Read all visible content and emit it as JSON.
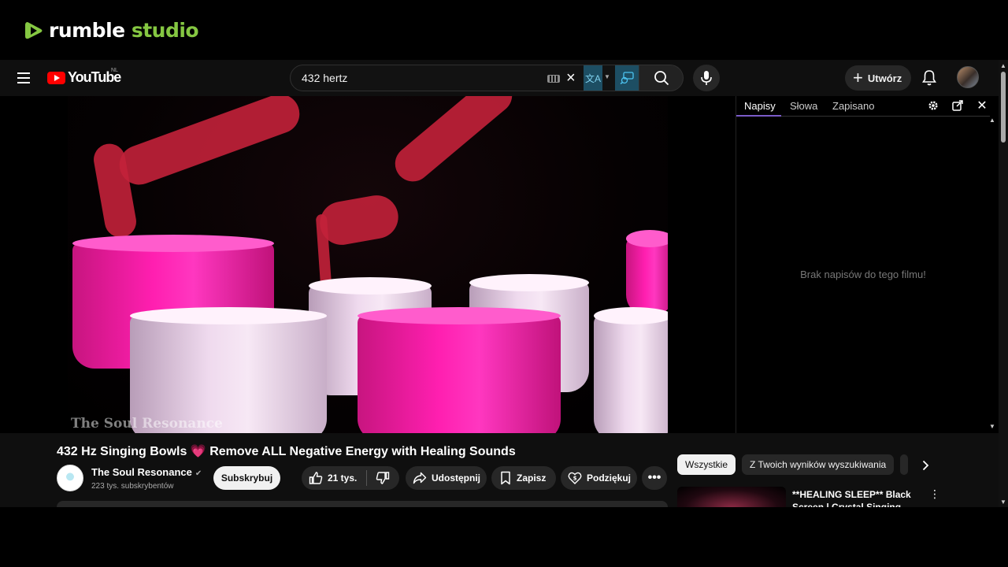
{
  "rumble": {
    "logo_word1": "rumble",
    "logo_word2": "studio",
    "brand_color": "#85c742"
  },
  "youtube": {
    "logo_text": "YouTube",
    "region": "NL",
    "search": {
      "value": "432 hertz"
    },
    "create_label": "Utwórz"
  },
  "side_panel": {
    "tabs": [
      "Napisy",
      "Słowa",
      "Zapisano"
    ],
    "active_tab": "Napisy",
    "empty_message": "Brak napisów do tego filmu!",
    "accent": "#7b5cc9"
  },
  "video": {
    "watermark": "The Soul Resonance",
    "title_part1": "432 Hz Singing Bowls",
    "title_emoji": "💗",
    "title_part2": "Remove ALL Negative Energy with Healing Sounds"
  },
  "channel": {
    "name": "The Soul Resonance",
    "subscribers": "223 tys. subskrybentów",
    "subscribe_label": "Subskrybuj"
  },
  "actions": {
    "likes": "21 tys.",
    "share": "Udostępnij",
    "save": "Zapisz",
    "thanks": "Podziękuj"
  },
  "chips": [
    "Wszystkie",
    "Z Twoich wyników wyszukiwania"
  ],
  "related": {
    "title": "**HEALING SLEEP** Black Screen | Crystal Singing Bowls"
  }
}
